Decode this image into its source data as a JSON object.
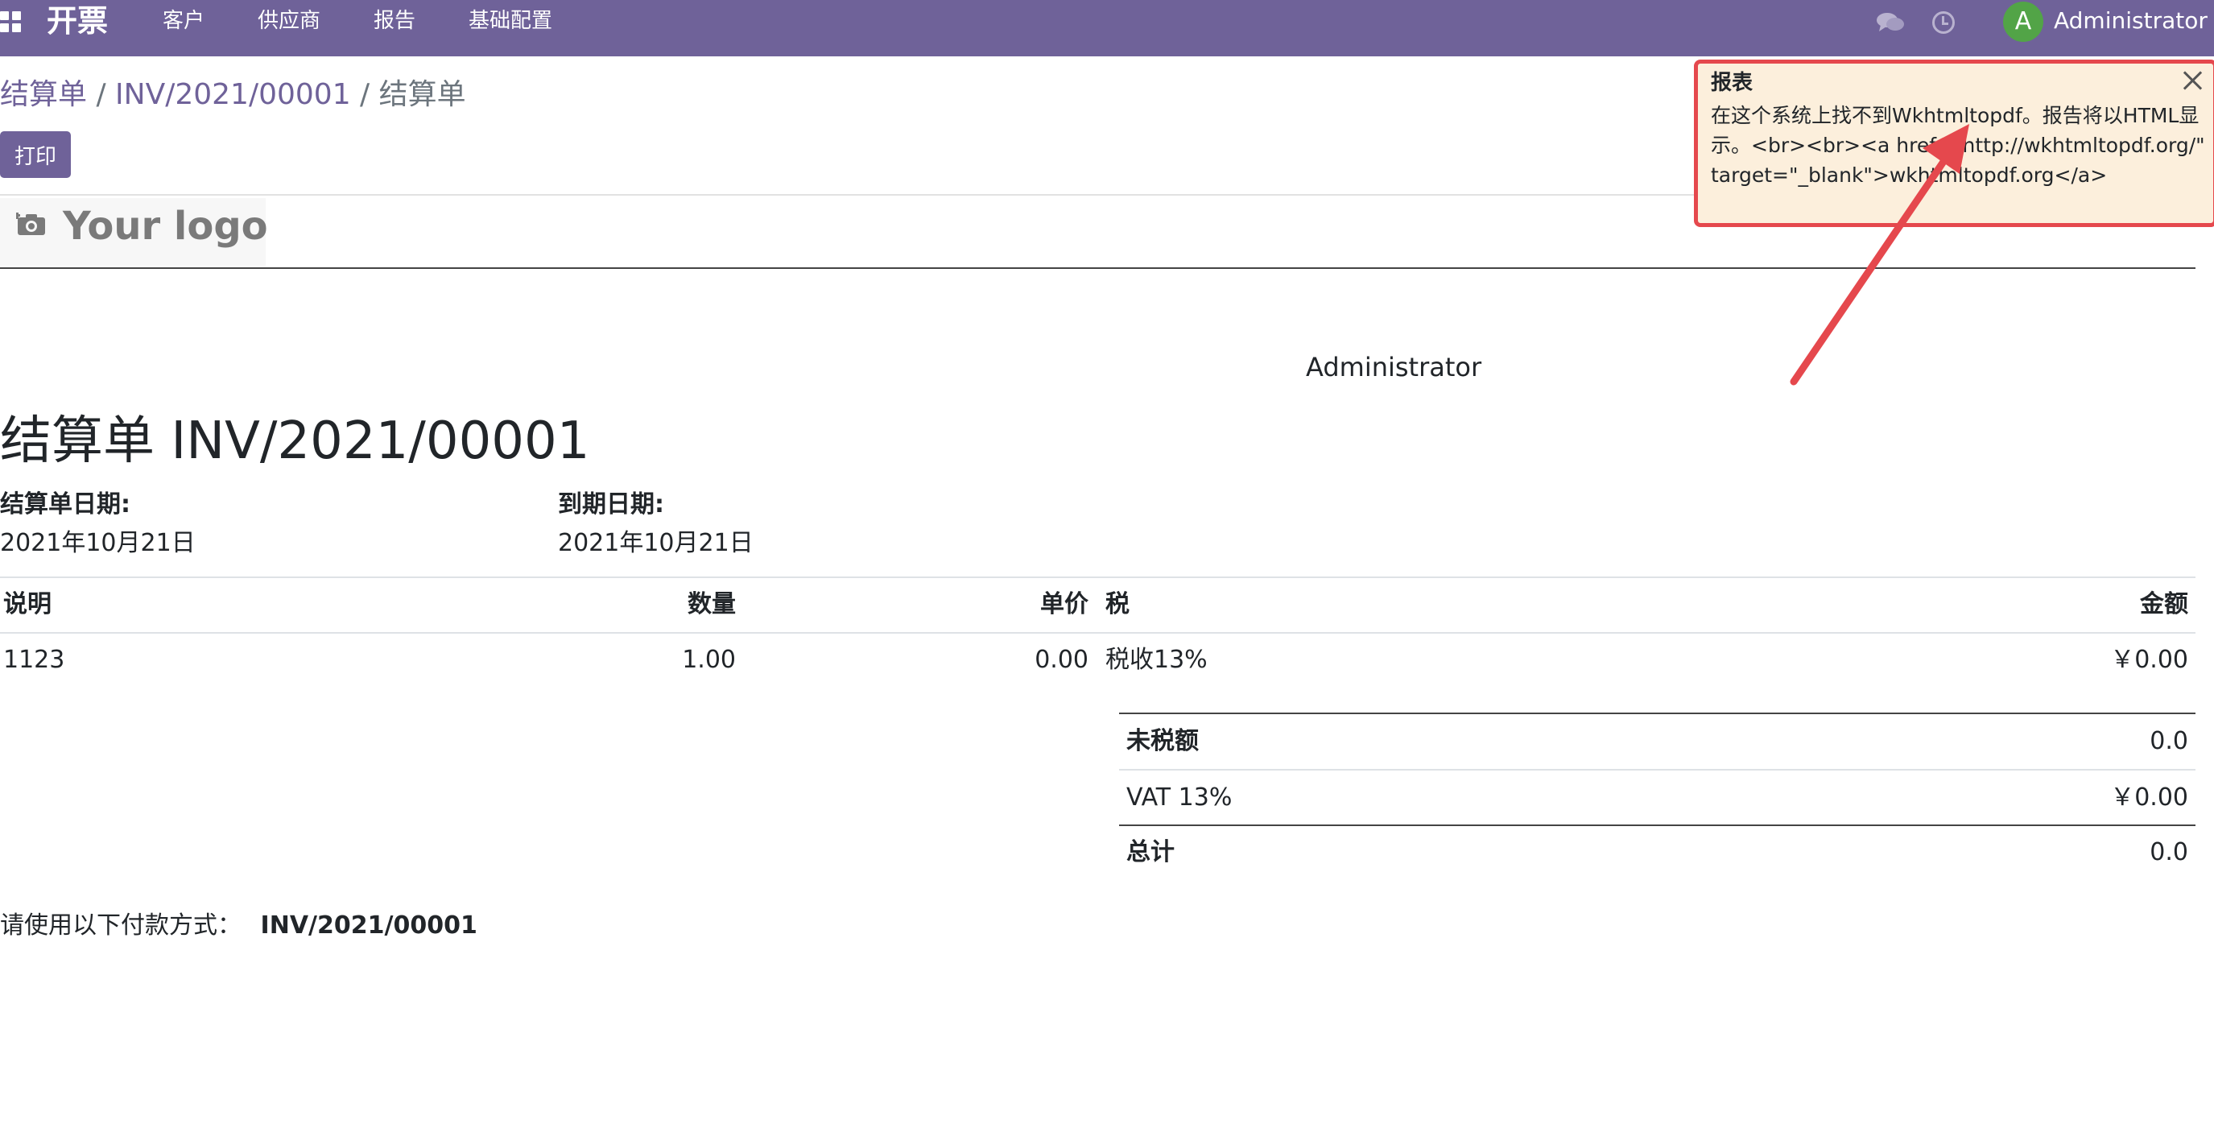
{
  "navbar": {
    "app_title": "开票",
    "menu": [
      "客户",
      "供应商",
      "报告",
      "基础配置"
    ],
    "user": {
      "initial": "A",
      "name": "Administrator"
    },
    "icons": [
      "apps-icon",
      "chat-icon",
      "clock-icon"
    ]
  },
  "control_panel": {
    "breadcrumb": [
      "结算单",
      "INV/2021/00001",
      "结算单"
    ],
    "breadcrumb_sep": " / ",
    "print_label": "打印"
  },
  "report": {
    "logo_text": "Your logo",
    "partner": "Administrator",
    "title": "结算单 INV/2021/00001",
    "invoice_date_label": "结算单日期:",
    "invoice_date": "2021年10月21日",
    "due_date_label": "到期日期:",
    "due_date": "2021年10月21日",
    "table": {
      "headers": [
        "说明",
        "数量",
        "单价",
        "税",
        "金额"
      ],
      "rows": [
        {
          "description": "1123",
          "quantity": "1.00",
          "unit_price": "0.00",
          "tax": "税收13%",
          "amount": "￥0.00"
        }
      ]
    },
    "totals": [
      {
        "label": "未税额",
        "value": "0.0"
      },
      {
        "label": "VAT 13%",
        "value": "￥0.00"
      },
      {
        "label": "总计",
        "value": "0.0"
      }
    ],
    "payment_text": "请使用以下付款方式：",
    "payment_ref": "INV/2021/00001"
  },
  "notification": {
    "title": "报表",
    "message": "在这个系统上找不到Wkhtmltopdf。报告将以HTML显示。<br><br><a href=\"http://wkhtmltopdf.org/\" target=\"_blank\">wkhtmltopdf.org</a>"
  },
  "colors": {
    "navbar": "#6f6299",
    "accent": "#6f6299",
    "avatar": "#52a447",
    "notification_bg": "#fcefdc",
    "annotation": "#e5484d"
  }
}
